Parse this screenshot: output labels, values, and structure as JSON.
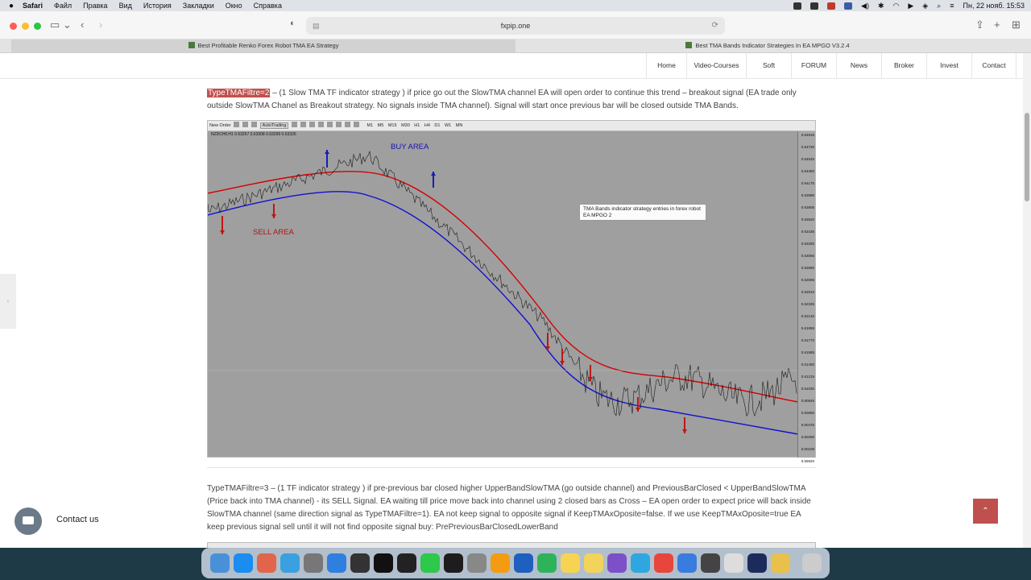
{
  "menubar": {
    "app": "Safari",
    "items": [
      "Файл",
      "Правка",
      "Вид",
      "История",
      "Закладки",
      "Окно",
      "Справка"
    ],
    "clock": "Пн, 22 нояб.  15:53"
  },
  "browser": {
    "address": "fxpip.one",
    "tabs": [
      {
        "label": "Best Profitable Renko Forex Robot TMA EA Strategy",
        "active": true
      },
      {
        "label": "Best TMA Bands Indicator Strategies In EA MPGO V3.2.4",
        "active": false
      }
    ]
  },
  "site_nav": {
    "items": [
      "Home",
      "Video-Courses",
      "Soft",
      "FORUM",
      "News",
      "Broker",
      "Invest",
      "Contact"
    ]
  },
  "article": {
    "para1_highlight": "TypeTMAFiltre=2",
    "para1_text": " – (1 Slow TMA TF indicator strategy ) if price go out the SlowTMA channel EA will open order to continue this trend – breakout signal (EA trade only outside SlowTMA Chanel as Breakout strategy. No signals inside TMA channel). Signal will start once previous bar will be closed outside TMA Bands.",
    "para2_text": "TypeTMAFiltre=3 – (1 TF indicator strategy ) if pre-previous bar closed higher UpperBandSlowTMA (go outside channel) and PreviousBarClosed < UpperBandSlowTMA (Price back into TMA channel) - its SELL Signal. EA waiting till price move back into channel using 2 closed bars as Cross – EA open order to expect price will back inside SlowTMA channel (same direction signal as TypeTMAFiltre=1). EA not keep signal to opposite signal if KeepTMAxOposite=false. If we use KeepTMAxOposite=true EA keep previous signal sell until it will not find opposite signal buy: PrePreviousBarClosedLowerBand"
  },
  "chart": {
    "toolbar_text": "New Order",
    "autotrading": "AutoTrading",
    "timeframes": [
      "M1",
      "M5",
      "M15",
      "M30",
      "H1",
      "H4",
      "D1",
      "W1",
      "MN"
    ],
    "symbol_info": "NZDCHF,H1  0.63257 0.63308 0.63299 0.63326",
    "buy_label": "BUY AREA",
    "sell_label": "SELL AREA",
    "tooltip": "TMA Bands indicator strategy entries in forex robot EA MPGO 2",
    "price_scale": [
      "0.64915",
      "0.64730",
      "0.64545",
      "0.64360",
      "0.64175",
      "0.63990",
      "0.63805",
      "0.63620",
      "0.63435",
      "0.63250",
      "0.63065",
      "0.62880",
      "0.62695",
      "0.62510",
      "0.62325",
      "0.62140",
      "0.61955",
      "0.61770",
      "0.61585",
      "0.61400",
      "0.61215",
      "0.61030",
      "0.60845",
      "0.60660",
      "0.60475",
      "0.60290",
      "0.60105",
      "0.59920"
    ],
    "colors": {
      "upper_band": "#d40000",
      "lower_band": "#1010d0",
      "price": "#1a1a1a",
      "background": "#9f9f9f"
    }
  },
  "widgets": {
    "contact_label": "Contact us",
    "to_top": "⌃"
  }
}
